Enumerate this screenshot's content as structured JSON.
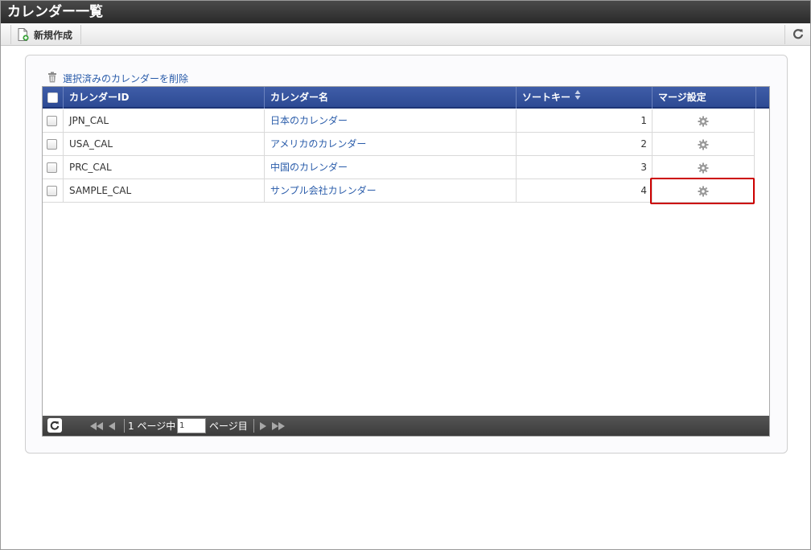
{
  "window": {
    "title": "カレンダー一覧"
  },
  "toolbar": {
    "new_label": "新規作成",
    "new_icon": "new-document-icon",
    "refresh_icon": "refresh-icon"
  },
  "actions": {
    "delete_selected": "選択済みのカレンダーを削除",
    "delete_icon": "trash-icon"
  },
  "table": {
    "columns": [
      "カレンダーID",
      "カレンダー名",
      "ソートキー",
      "マージ設定"
    ],
    "rows": [
      {
        "id": "JPN_CAL",
        "name": "日本のカレンダー",
        "sort_key": "1"
      },
      {
        "id": "USA_CAL",
        "name": "アメリカのカレンダー",
        "sort_key": "2"
      },
      {
        "id": "PRC_CAL",
        "name": "中国のカレンダー",
        "sort_key": "3"
      },
      {
        "id": "SAMPLE_CAL",
        "name": "サンプル会社カレンダー",
        "sort_key": "4"
      }
    ]
  },
  "pager": {
    "page_prefix": "1 ページ中",
    "page_value": "1",
    "page_suffix": "ページ目"
  },
  "colors": {
    "header_blue": "#2d4a93",
    "link": "#2a5caa",
    "highlight": "#cc0000"
  }
}
